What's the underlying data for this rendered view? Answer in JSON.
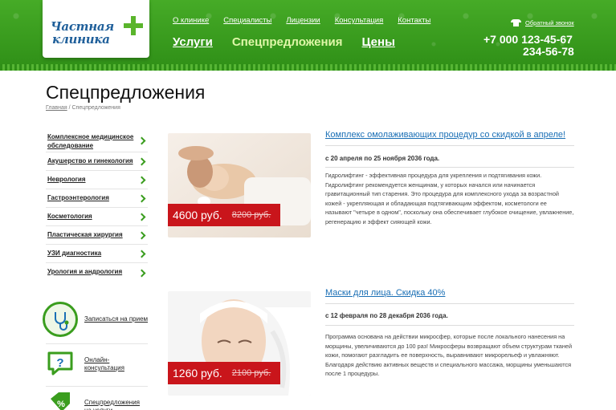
{
  "logo": {
    "line1": "Частная",
    "line2": "клиника"
  },
  "topnav": [
    "О клинике",
    "Специалисты",
    "Лицензии",
    "Консультация",
    "Контакты"
  ],
  "mainnav": [
    "Услуги",
    "Спецпредложения",
    "Цены"
  ],
  "header": {
    "callback": "Обратный звонок",
    "phone1": "+7 000   123-45-67",
    "phone2": "234-56-78"
  },
  "page_title": "Спецпредложения",
  "breadcrumb": {
    "home": "Главная",
    "sep": " / ",
    "current": "Спецпредложения"
  },
  "sidebar": {
    "items": [
      "Комплексное медицинское обследование",
      "Акушерство и гинекология",
      "Неврология",
      "Гастроэнтерология",
      "Косметология",
      "Пластическая хирургия",
      "УЗИ диагностика",
      "Урология и андрология"
    ],
    "links": [
      {
        "label": "Записаться на прием",
        "icon": "stethoscope-icon"
      },
      {
        "label": "Онлайн-консультация",
        "icon": "question-chat-icon"
      },
      {
        "label": "Спецпредложения на услуги",
        "icon": "percent-tag-icon"
      }
    ]
  },
  "offers": [
    {
      "title": "Комплекс омолаживающих процедур со скидкой в апреле!",
      "date": "с 20 апреля по 25 ноября 2036 года.",
      "description": "Гидролифтинг  - эффективная процедура для укрепления и подтягивания кожи. Гидролифтинг рекомендуется женщинам, у которых начался или начинается гравитационный тип старения. Это процедура для комплексного ухода за возрастной кожей - укрепляющая и обладающая подтягивающим эффектом, косметологи ее называют \"четыре в одном\", поскольку она обеспечивает глубокое очищение, увлажнение, регенерацию и эффект сияющей кожи.",
      "price_new": "4600 руб.",
      "price_old": "8200 руб."
    },
    {
      "title": "Маски для лица. Скидка 40%",
      "date": "с 12 февраля по 28 декабря 2036 года.",
      "description": "Программа основана на действии микросфер, которые после локального нанесения на морщины, увеличиваются до 100 раз! Микросферы возвращают объем структурам тканей кожи, помогают разгладить ее поверхность, выравнивают микрорельеф и увлажняют. Благодаря действию активных веществ и специального массажа, морщины уменьшаются после 1 процедуры.",
      "price_new": "1260 руб.",
      "price_old": "2100 руб."
    }
  ],
  "colors": {
    "brand_green": "#3a9d1e",
    "link_blue": "#1a6fb5",
    "price_red": "#c9151b"
  }
}
